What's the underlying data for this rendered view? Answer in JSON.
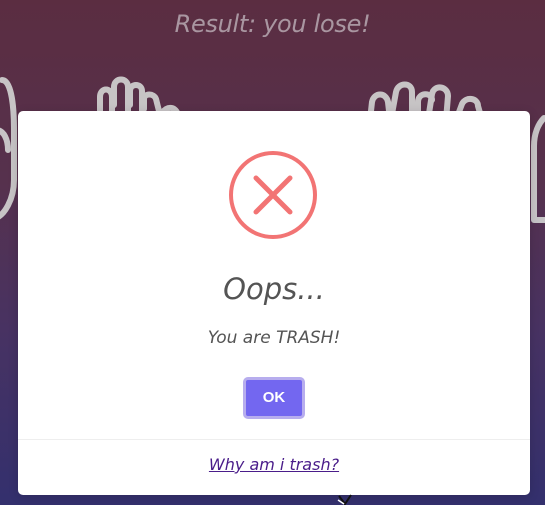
{
  "game": {
    "result_text": "Result: you lose!"
  },
  "dialog": {
    "icon": "error-x-circle-icon",
    "title": "Oops...",
    "message": "You are TRASH!",
    "ok_label": "OK",
    "footer_link": "Why am i trash?"
  },
  "colors": {
    "error_icon": "#f27474",
    "confirm_button": "#7367f0",
    "link": "#4a1d8a",
    "text": "#545454"
  }
}
